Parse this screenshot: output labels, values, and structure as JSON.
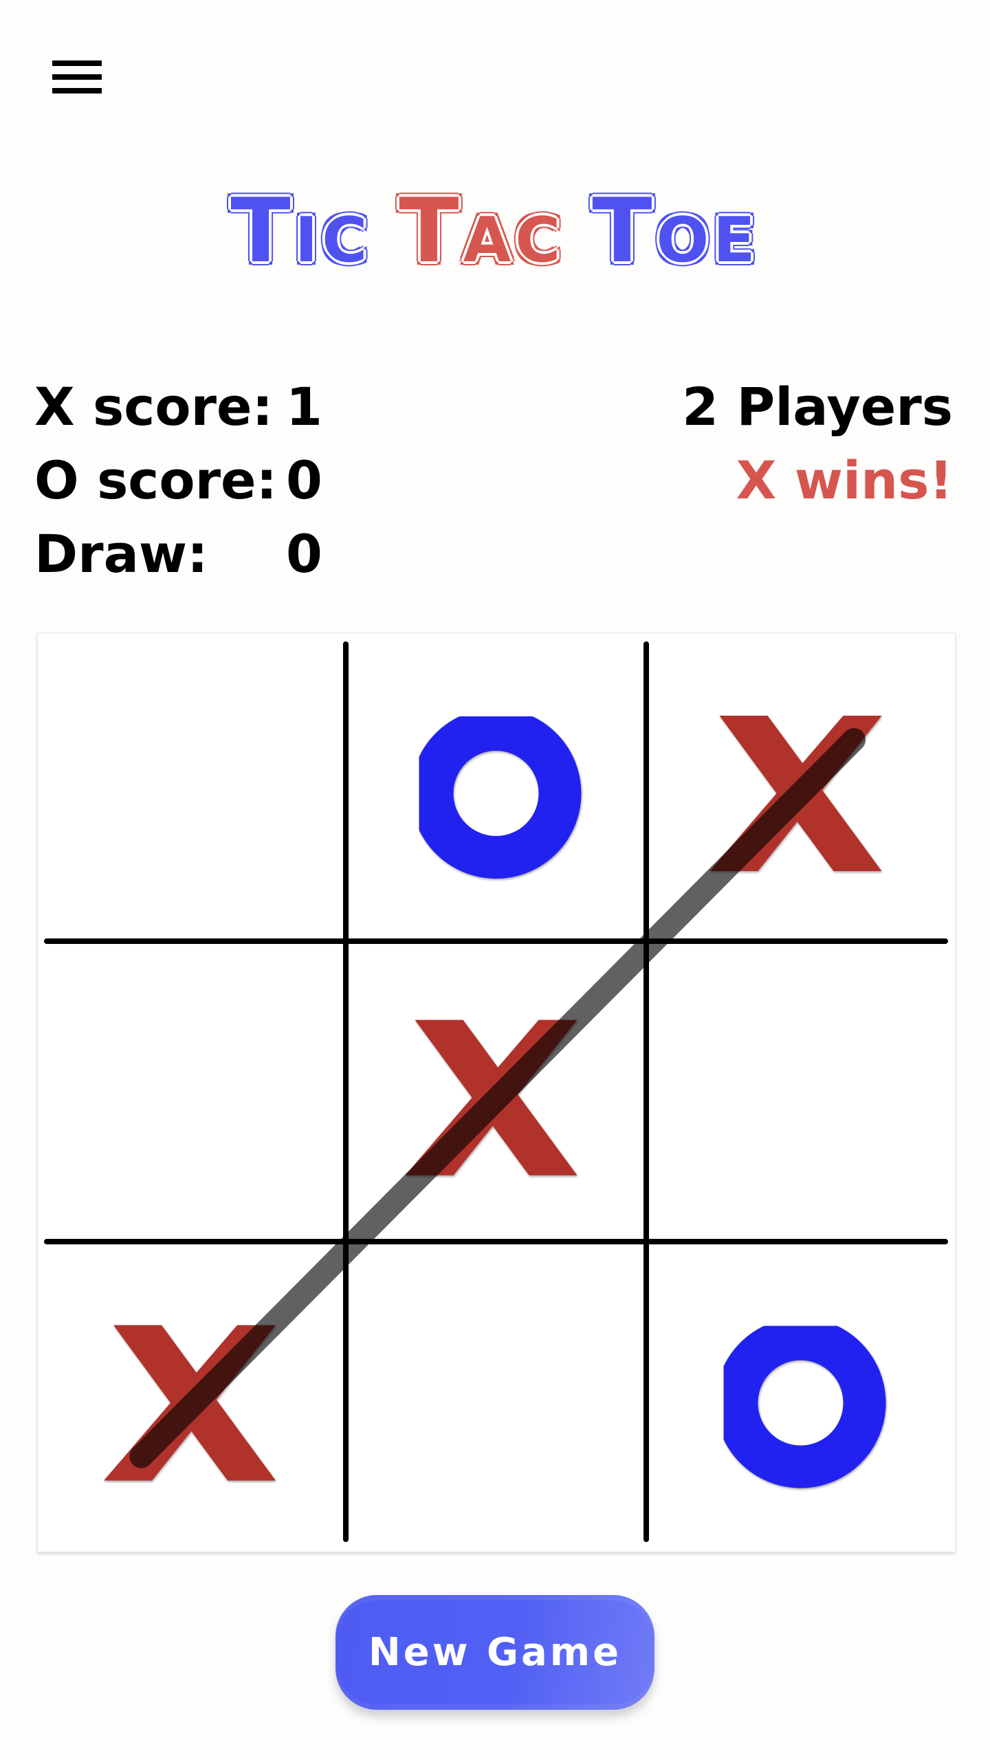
{
  "header": {
    "menu_icon": "hamburger-menu-icon"
  },
  "title": {
    "words": [
      "Tic",
      "Tac",
      "Toe"
    ],
    "colors": [
      "#4f52f0",
      "#d5574f",
      "#4f52f0"
    ]
  },
  "scores": {
    "x_label": "X score:",
    "x_value": "1",
    "o_label": "O score:",
    "o_value": "0",
    "draw_label": "Draw:",
    "draw_value": "0"
  },
  "game_info": {
    "mode": "2 Players",
    "status": "X wins!",
    "status_color": "#d6564f"
  },
  "board": {
    "cells": [
      [
        "",
        "O",
        "X"
      ],
      [
        "",
        "X",
        ""
      ],
      [
        "X",
        "",
        "O"
      ]
    ],
    "winner": "X",
    "winning_line": [
      [
        2,
        0
      ],
      [
        1,
        1
      ],
      [
        0,
        2
      ]
    ],
    "colors": {
      "x": "#b0312b",
      "o": "#2121f0",
      "grid": "#000000",
      "win_line": "#555555"
    }
  },
  "actions": {
    "new_game_label": "New Game"
  }
}
